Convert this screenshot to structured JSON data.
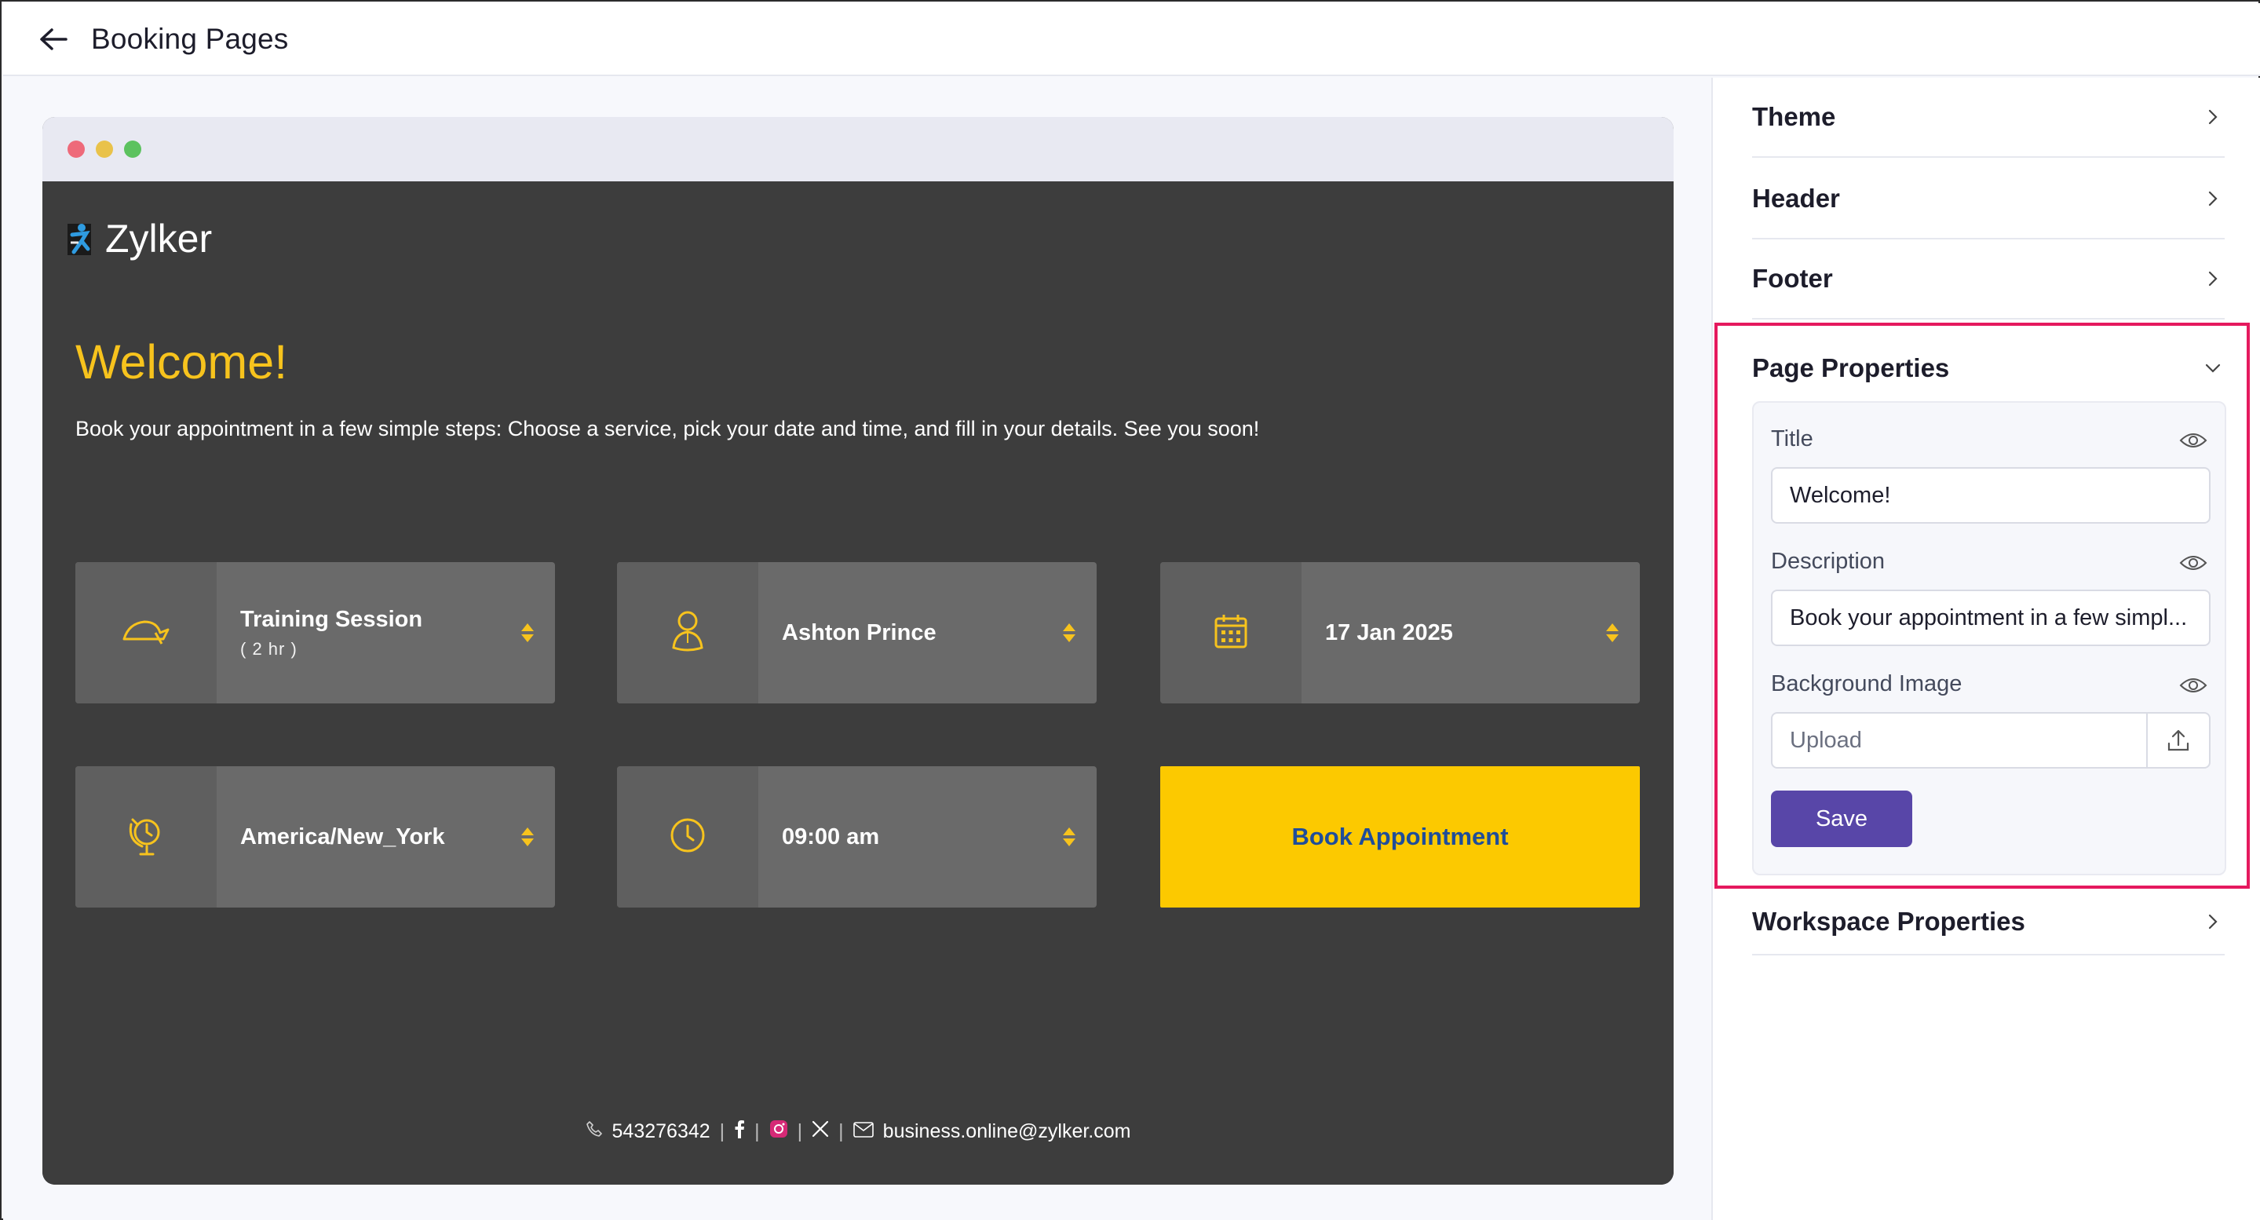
{
  "header": {
    "title": "Booking Pages"
  },
  "preview": {
    "brand": "Zylker",
    "welcome_title": "Welcome!",
    "intro": "Book your appointment in a few simple steps: Choose a service, pick your date and time, and fill in your details. See you soon!",
    "cards": {
      "service": {
        "label": "Training Session",
        "sub": "( 2 hr )"
      },
      "staff": {
        "label": "Ashton Prince"
      },
      "date": {
        "label": "17 Jan 2025"
      },
      "timezone": {
        "label": "America/New_York"
      },
      "time": {
        "label": "09:00 am"
      }
    },
    "book_button": "Book Appointment",
    "footer": {
      "phone": "543276342",
      "email": "business.online@zylker.com",
      "separator": "|"
    },
    "colors": {
      "accent": "#fcc900",
      "background": "#3d3d3d",
      "card": "#6a6a6a",
      "link": "#1f4d9a"
    }
  },
  "panel": {
    "sections": {
      "theme": "Theme",
      "header": "Header",
      "footer": "Footer",
      "page_properties": "Page Properties",
      "workspace_properties": "Workspace Properties"
    },
    "page_properties": {
      "title_label": "Title",
      "title_value": "Welcome!",
      "description_label": "Description",
      "description_value": "Book your appointment in a few simpl...",
      "bg_label": "Background Image",
      "upload_placeholder": "Upload",
      "save": "Save"
    },
    "colors": {
      "highlight": "#e5195e",
      "save": "#5846a8"
    }
  }
}
